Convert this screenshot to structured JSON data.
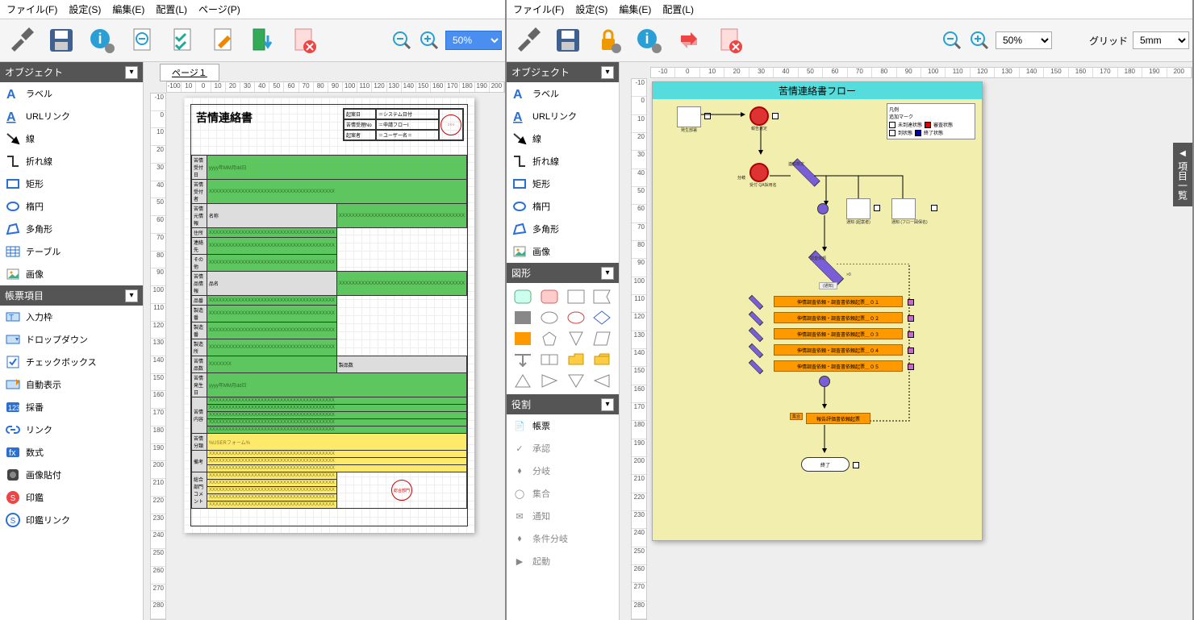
{
  "left": {
    "menu": [
      "ファイル(F)",
      "設定(S)",
      "編集(E)",
      "配置(L)",
      "ページ(P)"
    ],
    "zoom": "50%",
    "page_tab": "ページ１",
    "sections": {
      "objects": {
        "title": "オブジェクト",
        "items": [
          "ラベル",
          "URLリンク",
          "線",
          "折れ線",
          "矩形",
          "楕円",
          "多角形",
          "テーブル",
          "画像"
        ]
      },
      "form_items": {
        "title": "帳票項目",
        "items": [
          "入力枠",
          "ドロップダウン",
          "チェックボックス",
          "自動表示",
          "採番",
          "リンク",
          "数式",
          "画像貼付",
          "印鑑",
          "印鑑リンク"
        ]
      }
    },
    "ruler_h": [
      "-100",
      "10",
      "0",
      "10",
      "20",
      "30",
      "40",
      "50",
      "60",
      "70",
      "80",
      "90",
      "100",
      "110",
      "120",
      "130",
      "140",
      "150",
      "160",
      "170",
      "180",
      "190",
      "200"
    ],
    "ruler_v": [
      "-10",
      "0",
      "10",
      "20",
      "30",
      "40",
      "50",
      "60",
      "70",
      "80",
      "90",
      "100",
      "110",
      "120",
      "130",
      "140",
      "150",
      "160",
      "170",
      "180",
      "190",
      "200",
      "210",
      "220",
      "230",
      "240",
      "250",
      "260",
      "270",
      "280"
    ],
    "form": {
      "title": "苦情連絡書",
      "hdr": [
        {
          "k": "起案日",
          "v": "＝システム日付"
        },
        {
          "k": "苦情受理No",
          "v": "＝申請フローI"
        },
        {
          "k": "起案者",
          "v": "＝ユーザー名＝"
        }
      ],
      "stamp_label": "○○○",
      "date_ph": "yyyy年MM月dd日",
      "x_ph": "XXXXXXXXXXXXXXXXXXXXXXXXXXXXXXXXXXXXXXX",
      "rows": [
        {
          "lbl": "苦情受付日",
          "type": "date"
        },
        {
          "lbl": "苦情受付者",
          "type": "green"
        },
        {
          "lbl": "苦情元情報",
          "subs": [
            "名称",
            "住所",
            "連絡先",
            "その他"
          ],
          "type": "green"
        },
        {
          "lbl": "苦情品情報",
          "subs": [
            "品名",
            "品番",
            "製造番",
            "製造番",
            "製造所"
          ],
          "type": "green"
        },
        {
          "lbl2row": [
            "苦情品数",
            "製品数"
          ],
          "type": "green"
        },
        {
          "lbl": "苦情発生日",
          "type": "date"
        },
        {
          "lbl": "苦情内容",
          "type": "green",
          "tall": 5
        },
        {
          "lbl": "苦情分類",
          "val": "%USERフォーム%"
        },
        {
          "lbl": "備考",
          "type": "yellow",
          "tall": 3
        },
        {
          "lbl": "総合部門\\nコメント",
          "type": "yellow",
          "tall": 5,
          "stamp": "総合部門"
        }
      ]
    }
  },
  "right": {
    "menu": [
      "ファイル(F)",
      "設定(S)",
      "編集(E)",
      "配置(L)"
    ],
    "zoom": "50%",
    "grid_label": "グリッド",
    "grid_value": "5mm",
    "sections": {
      "objects": {
        "title": "オブジェクト",
        "items": [
          "ラベル",
          "URLリンク",
          "線",
          "折れ線",
          "矩形",
          "楕円",
          "多角形",
          "画像"
        ]
      },
      "shapes": {
        "title": "図形"
      },
      "roles": {
        "title": "役割",
        "items": [
          "帳票",
          "承認",
          "分岐",
          "集合",
          "通知",
          "条件分岐",
          "起動"
        ]
      }
    },
    "ruler_h": [
      "-10",
      "0",
      "10",
      "20",
      "30",
      "40",
      "50",
      "60",
      "70",
      "80",
      "90",
      "100",
      "110",
      "120",
      "130",
      "140",
      "150",
      "160",
      "170",
      "180",
      "190",
      "200"
    ],
    "ruler_v": [
      "-10",
      "0",
      "10",
      "20",
      "30",
      "40",
      "50",
      "60",
      "70",
      "80",
      "90",
      "100",
      "110",
      "120",
      "130",
      "140",
      "150",
      "160",
      "170",
      "180",
      "190",
      "200",
      "210",
      "220",
      "230",
      "240",
      "250",
      "260",
      "270",
      "280"
    ],
    "flow": {
      "title": "苦情連絡書フロー",
      "legend": {
        "title": "凡例",
        "subtitle": "追加マーク",
        "items": [
          {
            "label": "未到達状態",
            "color": "#fff"
          },
          {
            "label": "審査状態",
            "color": "#d00"
          },
          {
            "label": "到状態",
            "color": "#fff"
          },
          {
            "label": "終了状態",
            "color": "#00a"
          }
        ]
      },
      "nodes": {
        "start1": "発生部署",
        "start2": "報告選定",
        "branch": "分岐",
        "recv": "受付\\nQA採用名",
        "notify1": "通知\\n(起案者)",
        "notify2": "通知\\n(フロー図保名)",
        "decision1": "連知規定",
        "decision2": "調査依頼",
        "gt0": ">0",
        "mid": "(通知)",
        "tasks": [
          "伸情調査依頼・調査書依頼起票＿０１",
          "伸情調査依頼・調査書依頼起票＿０２",
          "伸情調査依頼・調査書依頼起票＿０３",
          "伸情調査依頼・調査書依頼起票＿０４",
          "伸情調査依頼・調査書依頼起票＿０５"
        ],
        "collect": "集合",
        "collect2": "報告評価書依頼起票",
        "end": "終了"
      }
    },
    "side_tab": "項目一覧"
  }
}
